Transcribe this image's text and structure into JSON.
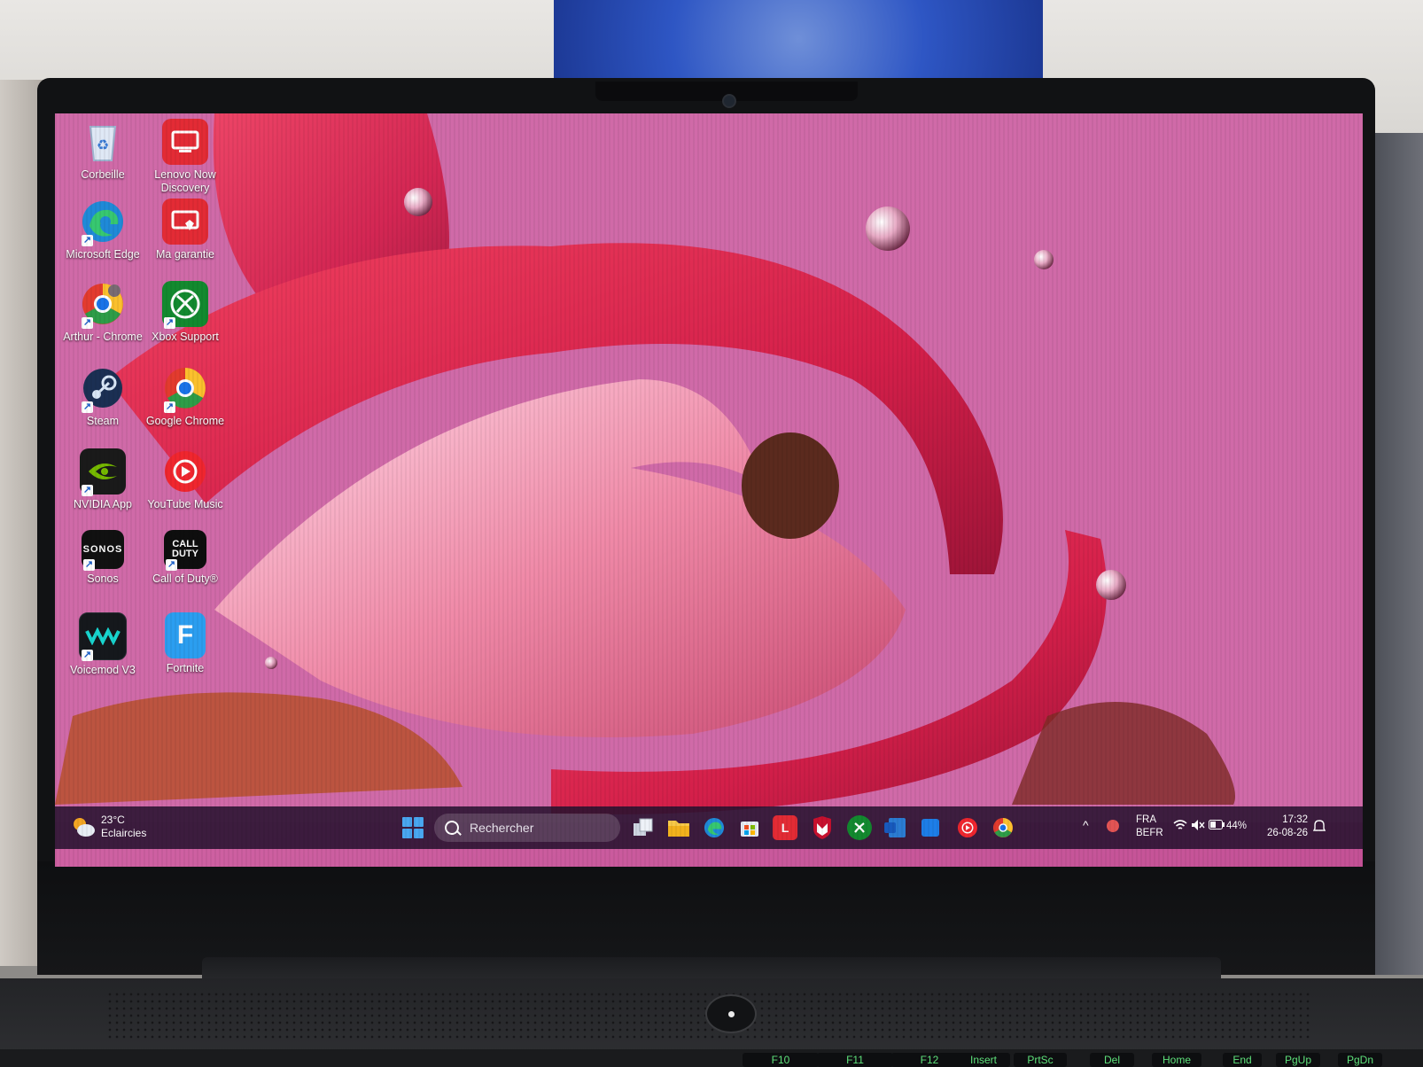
{
  "desktop_icons": [
    {
      "label": "Corbeille",
      "icon": "recycle-bin-icon"
    },
    {
      "label": "Lenovo Now Discovery",
      "icon": "lenovo-now-icon"
    },
    {
      "label": "Microsoft Edge",
      "icon": "edge-icon"
    },
    {
      "label": "Ma garantie",
      "icon": "warranty-icon"
    },
    {
      "label": "Arthur - Chrome",
      "icon": "chrome-profile-icon"
    },
    {
      "label": "Xbox Support",
      "icon": "xbox-icon"
    },
    {
      "label": "Steam",
      "icon": "steam-icon"
    },
    {
      "label": "Google Chrome",
      "icon": "chrome-icon"
    },
    {
      "label": "NVIDIA App",
      "icon": "nvidia-icon"
    },
    {
      "label": "YouTube Music",
      "icon": "youtube-music-icon"
    },
    {
      "label": "Sonos",
      "icon": "sonos-icon",
      "logo_text": "SONOS"
    },
    {
      "label": "Call of Duty®",
      "icon": "call-of-duty-icon",
      "logo_text": "CALL DUTY"
    },
    {
      "label": "Voicemod V3",
      "icon": "voicemod-icon"
    },
    {
      "label": "Fortnite",
      "icon": "fortnite-icon",
      "logo_text": "F"
    }
  ],
  "taskbar": {
    "weather": {
      "temp": "23°C",
      "condition": "Eclaircies"
    },
    "search_placeholder": "Rechercher",
    "pinned_apps": [
      "task-view",
      "file-explorer",
      "edge",
      "microsoft-store",
      "lenovo-vantage",
      "mcafee",
      "xbox",
      "word",
      "windows-app",
      "youtube-music",
      "chrome"
    ],
    "lenovo_letter": "L",
    "tray": {
      "language": "FRA",
      "layout": "BEFR",
      "battery": "44%",
      "time": "17:32",
      "date": "26-08-26"
    }
  },
  "keyboard_keys": [
    "F10",
    "F11",
    "F12",
    "Insert",
    "PrtSc",
    "Del",
    "Home",
    "End",
    "PgUp",
    "PgDn"
  ],
  "colors": {
    "wallpaper_bg": "#d06aa8",
    "wallpaper_red": "#e2305a",
    "taskbar": "#28122f",
    "keyboard_backlight": "#5ee07a"
  }
}
